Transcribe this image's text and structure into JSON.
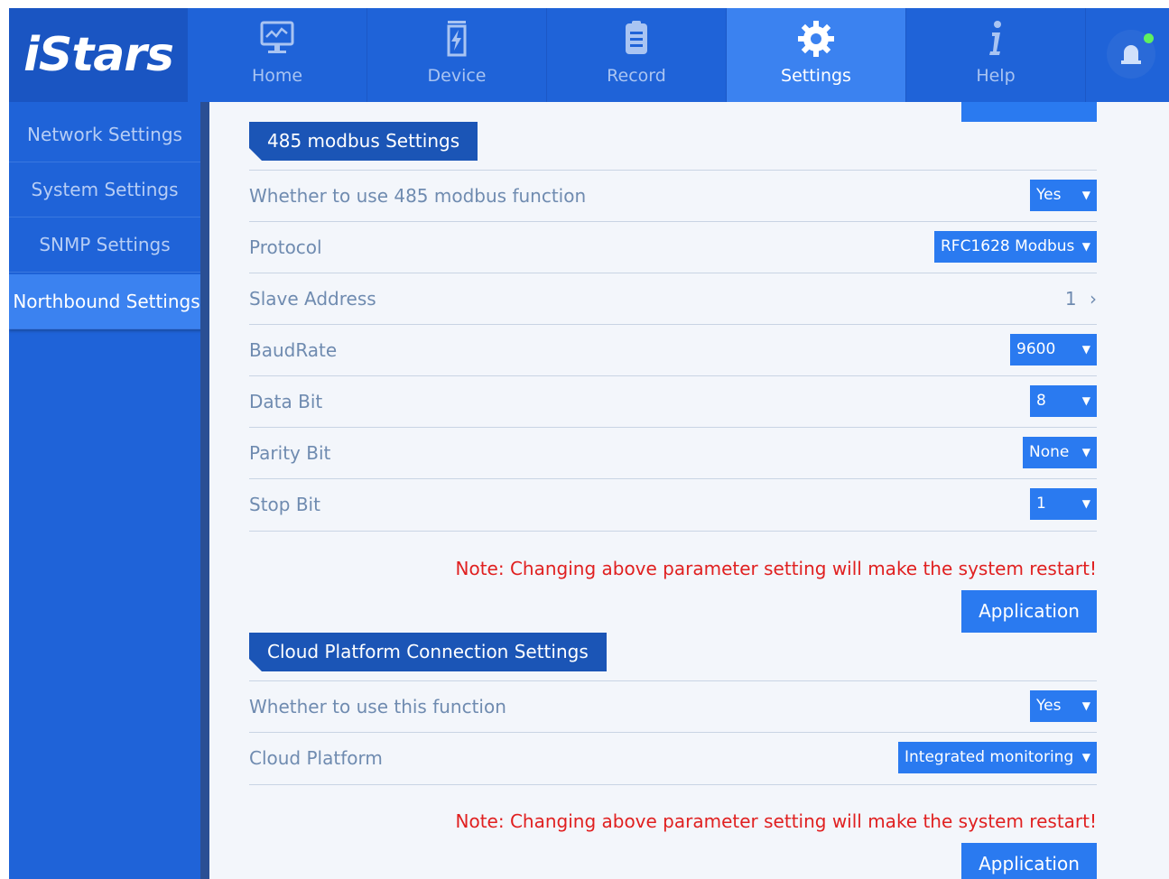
{
  "logo": {
    "text": "iStars"
  },
  "nav": {
    "home": "Home",
    "device": "Device",
    "record": "Record",
    "settings": "Settings",
    "help": "Help"
  },
  "sidebar": {
    "items": [
      {
        "label": "Network Settings"
      },
      {
        "label": "System Settings"
      },
      {
        "label": "SNMP Settings"
      },
      {
        "label": "Northbound Settings"
      }
    ],
    "active": "Northbound Settings"
  },
  "modbus": {
    "title": "485 modbus Settings",
    "use_label": "Whether to use 485 modbus function",
    "use_value": "Yes",
    "protocol_label": "Protocol",
    "protocol_value": "RFC1628 Modbus",
    "slave_label": "Slave Address",
    "slave_value": "1",
    "baud_label": "BaudRate",
    "baud_value": "9600",
    "databit_label": "Data Bit",
    "databit_value": "8",
    "parity_label": "Parity Bit",
    "parity_value": "None",
    "stopbit_label": "Stop Bit",
    "stopbit_value": "1",
    "note": "Note: Changing above parameter setting will make the system restart!",
    "apply": "Application"
  },
  "cloud": {
    "title": "Cloud Platform Connection Settings",
    "use_label": "Whether to use this function",
    "use_value": "Yes",
    "platform_label": "Cloud Platform",
    "platform_value": "Integrated monitoring",
    "note": "Note: Changing above parameter setting will make the system restart!",
    "apply": "Application"
  },
  "icons": {
    "home": "monitor-chart-icon",
    "device": "battery-bolt-icon",
    "record": "clipboard-list-icon",
    "settings": "gear-icon",
    "help": "info-icon",
    "alarm": "alarm-bell-icon",
    "select": "chevron-down-icon",
    "slave": "chevron-right-icon"
  },
  "colors": {
    "header": "#1f63d8",
    "active_tab": "#3b82f0",
    "button": "#2a7af0",
    "section": "#1b55b6",
    "note": "#e02020",
    "alarm_indicator": "#5ff05f"
  }
}
